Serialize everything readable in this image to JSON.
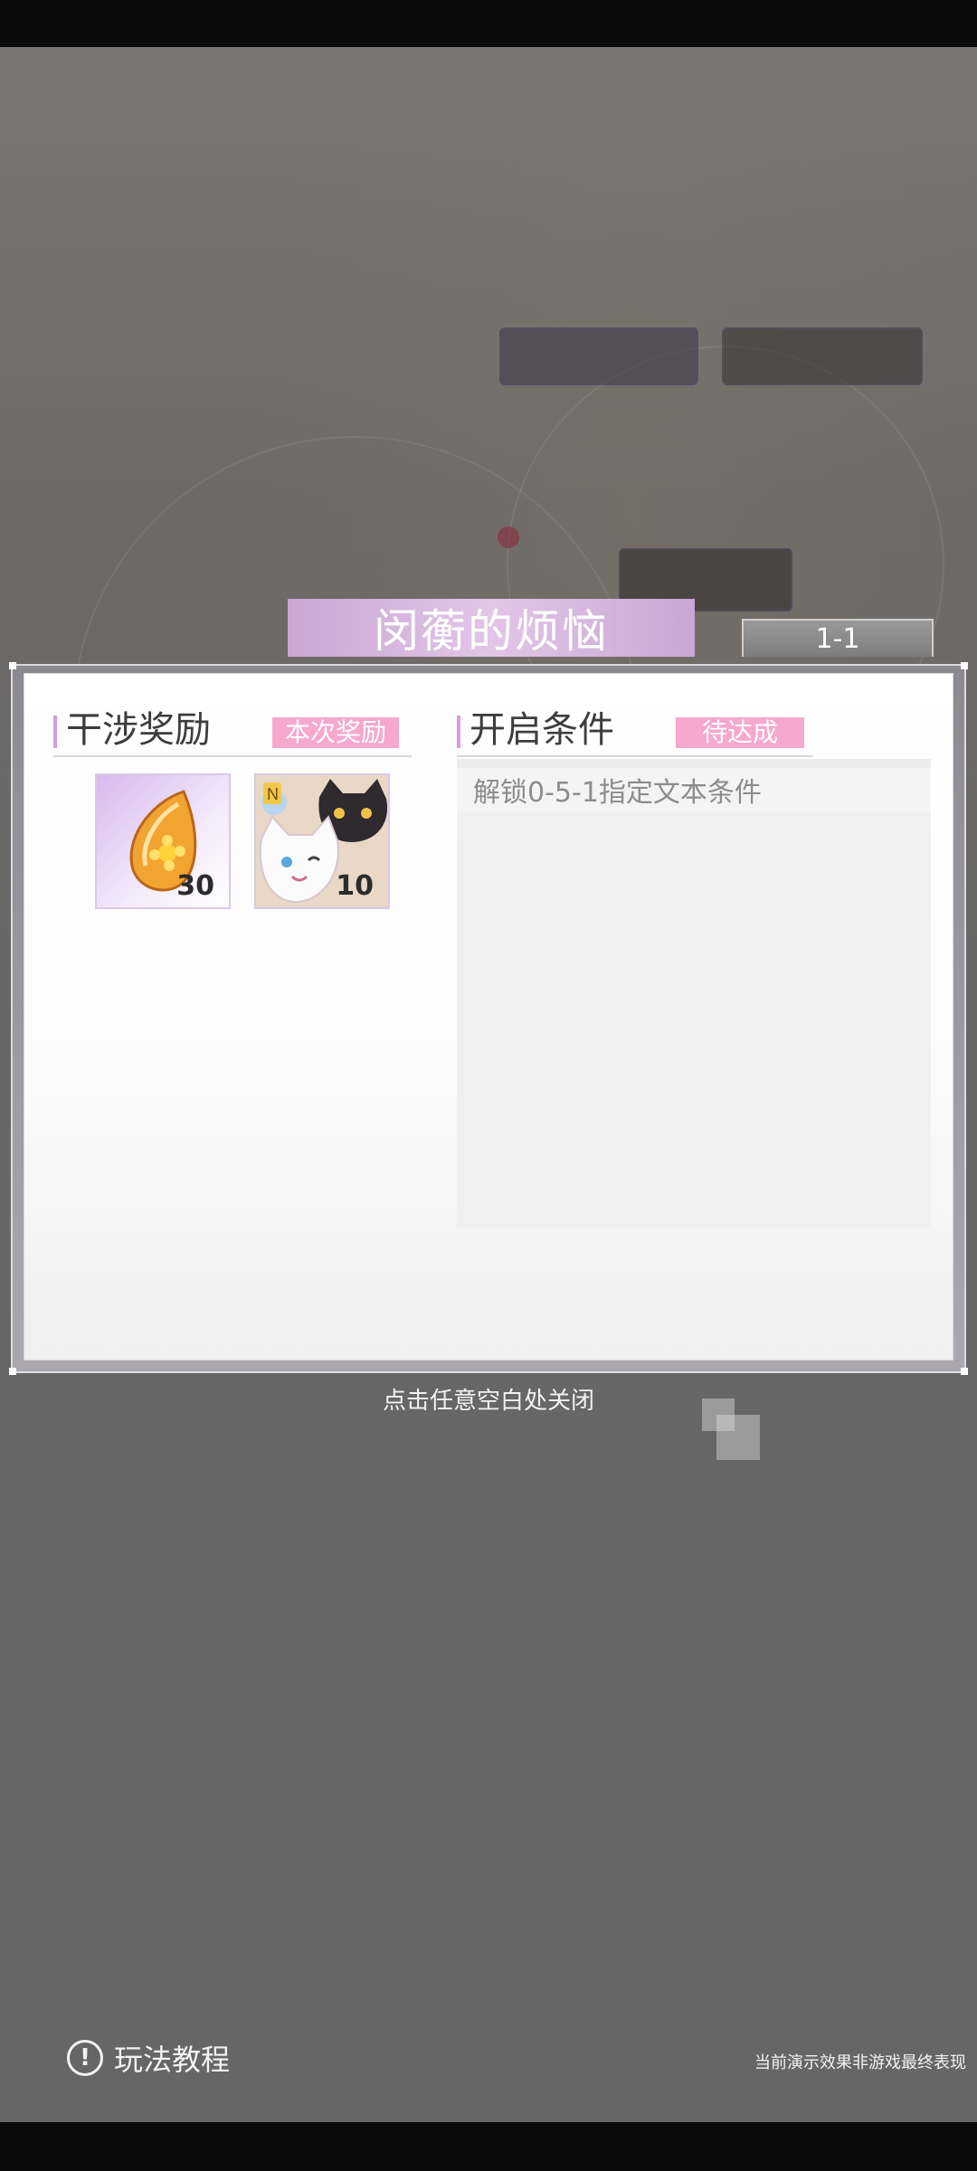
{
  "dialog": {
    "title": "闵蘅的烦恼",
    "stage": "1-1",
    "rewards_section": {
      "label": "干涉奖励",
      "tag": "本次奖励",
      "items": [
        {
          "icon": "amber-flower-stone-icon",
          "count": "30"
        },
        {
          "icon": "cats-card-icon",
          "count": "10"
        }
      ]
    },
    "conditions_section": {
      "label": "开启条件",
      "tag": "待达成",
      "conditions": [
        "解锁0-5-1指定文本条件"
      ]
    }
  },
  "close_hint": "点击任意空白处关闭",
  "tutorial": {
    "label": "玩法教程",
    "icon": "exclamation-circle-icon"
  },
  "disclaimer": "当前演示效果非游戏最终表现",
  "colors": {
    "accent_pink": "#f6a8cf",
    "accent_purple": "#d79be6",
    "banner": "#d9b8e0"
  }
}
